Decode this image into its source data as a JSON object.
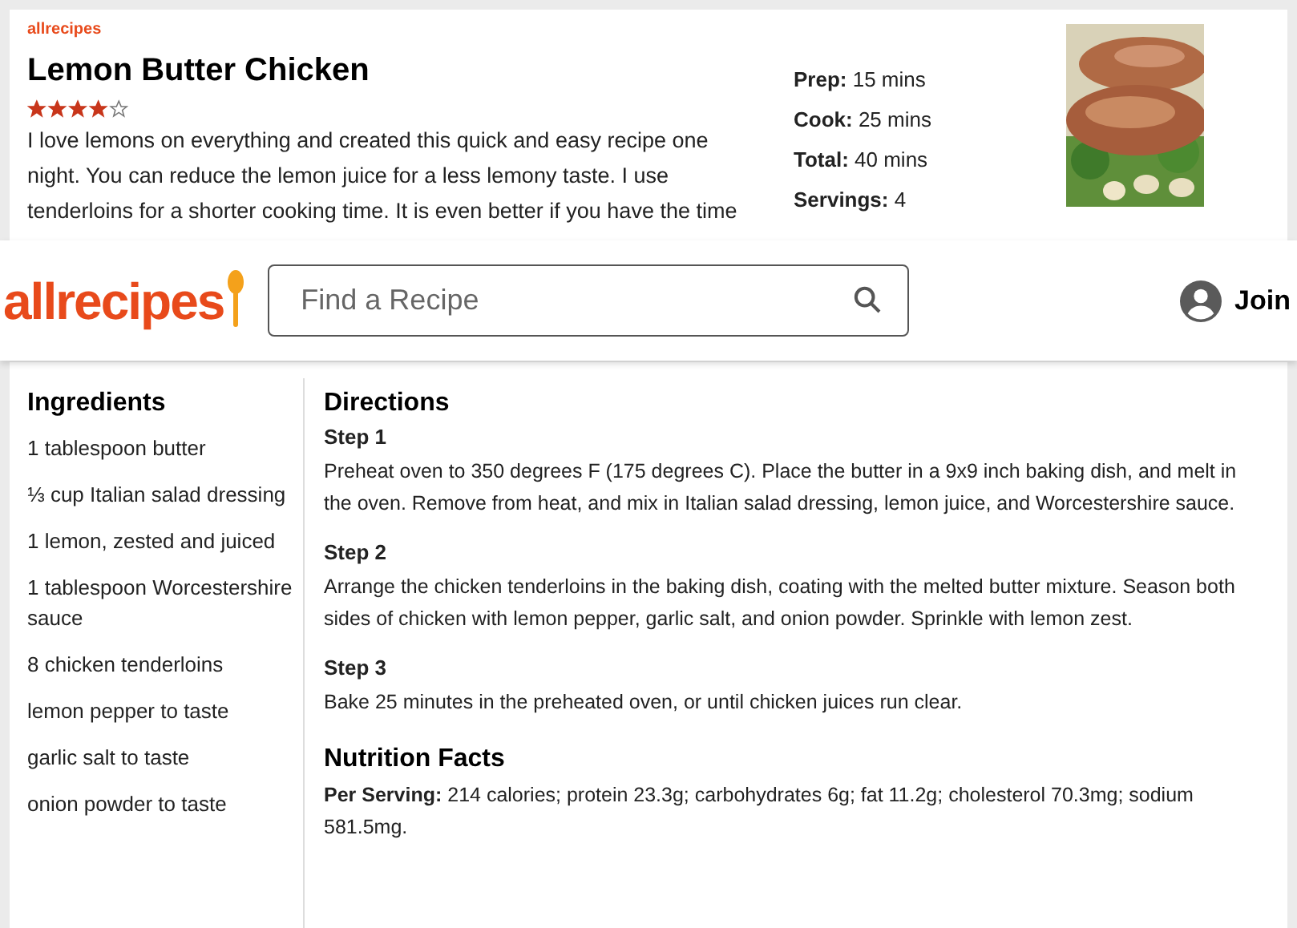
{
  "recipe_card": {
    "logo": "allrecipes",
    "title": "Lemon Butter Chicken",
    "stars": 4,
    "description": "I love lemons on everything and created this quick and easy recipe one night. You can reduce the lemon juice for a less lemony taste. I use tenderloins for a shorter cooking time. It is even better if you have the time",
    "meta": [
      "**Prep:** 15 mins",
      "**Cook:** 25 mins",
      "**Total:** 40 mins",
      "**Servings:** 4"
    ]
  },
  "header": {
    "logo": "allrecipes",
    "search": {
      "placeholder": "Find a Recipe"
    },
    "join": "Join"
  },
  "ingredients": {
    "title": "Ingredients",
    "items": [
      "1 tablespoon butter",
      "⅓ cup Italian salad dressing",
      "1 lemon, zested and juiced",
      "1 tablespoon Worcestershire sauce",
      "8 chicken tenderloins",
      "lemon pepper to taste",
      "garlic salt to taste",
      "onion powder to taste"
    ]
  },
  "directions": {
    "title": "Directions",
    "steps": [
      {
        "title": "Step 1",
        "text": "Preheat oven to 350 degrees F (175 degrees C). Place the butter in a 9x9 inch baking dish, and melt in the oven. Remove from heat, and mix in Italian salad dressing, lemon juice, and Worcestershire sauce."
      },
      {
        "title": "Step 2",
        "text": "Arrange the chicken tenderloins in the baking dish, coating with the melted butter mixture. Season both sides of chicken with lemon pepper, garlic salt, and onion powder. Sprinkle with lemon zest."
      },
      {
        "title": "Step 3",
        "text": "Bake 25 minutes in the preheated oven, or until chicken juices run clear."
      }
    ]
  },
  "nutrition": {
    "title": "Nutrition Facts",
    "text": "**Per Serving:** 214 calories; protein 23.3g; carbohydrates 6g; fat 11.2g; cholesterol 70.3mg; sodium 581.5mg."
  }
}
